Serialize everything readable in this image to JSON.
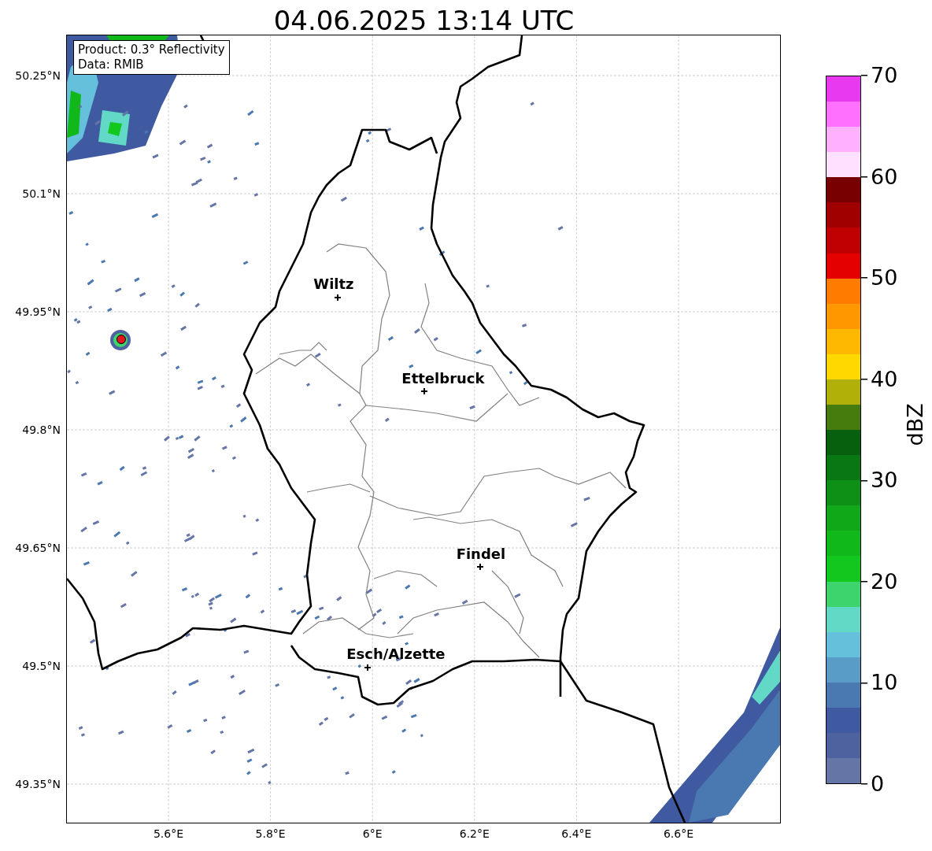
{
  "title": "04.06.2025 13:14 UTC",
  "info_box": {
    "lines": [
      "Product: 0.3° Reflectivity",
      "Data: RMIB"
    ]
  },
  "map": {
    "yticks": [
      "50.25°N",
      "50.1°N",
      "49.95°N",
      "49.8°N",
      "49.65°N",
      "49.5°N",
      "49.35°N"
    ],
    "xticks": [
      "5.6°E",
      "5.8°E",
      "6°E",
      "6.2°E",
      "6.4°E",
      "6.6°E"
    ],
    "cities": [
      "Wiltz",
      "Ettelbruck",
      "Findel",
      "Esch/Alzette"
    ]
  },
  "colorbar": {
    "label": "dBZ",
    "ticks": [
      "70",
      "60",
      "50",
      "40",
      "30",
      "20",
      "10",
      "0"
    ],
    "bands": [
      {
        "color": "#e838f0"
      },
      {
        "color": "#ff70ff"
      },
      {
        "color": "#ffb0ff"
      },
      {
        "color": "#ffe0ff"
      },
      {
        "color": "#780000"
      },
      {
        "color": "#a00000"
      },
      {
        "color": "#c00000"
      },
      {
        "color": "#e40000"
      },
      {
        "color": "#ff7c00"
      },
      {
        "color": "#ff9800"
      },
      {
        "color": "#ffb800"
      },
      {
        "color": "#ffd800"
      },
      {
        "color": "#b0b008"
      },
      {
        "color": "#467c0e"
      },
      {
        "color": "#06600e"
      },
      {
        "color": "#0a7812"
      },
      {
        "color": "#0e9016"
      },
      {
        "color": "#10a818"
      },
      {
        "color": "#10b81a"
      },
      {
        "color": "#12c81e"
      },
      {
        "color": "#3dd46e"
      },
      {
        "color": "#62d8c6"
      },
      {
        "color": "#65c0dc"
      },
      {
        "color": "#5a9cc8"
      },
      {
        "color": "#4a78b0"
      },
      {
        "color": "#3f5aa0"
      },
      {
        "color": "#4f62a0"
      },
      {
        "color": "#6575a5"
      }
    ]
  }
}
